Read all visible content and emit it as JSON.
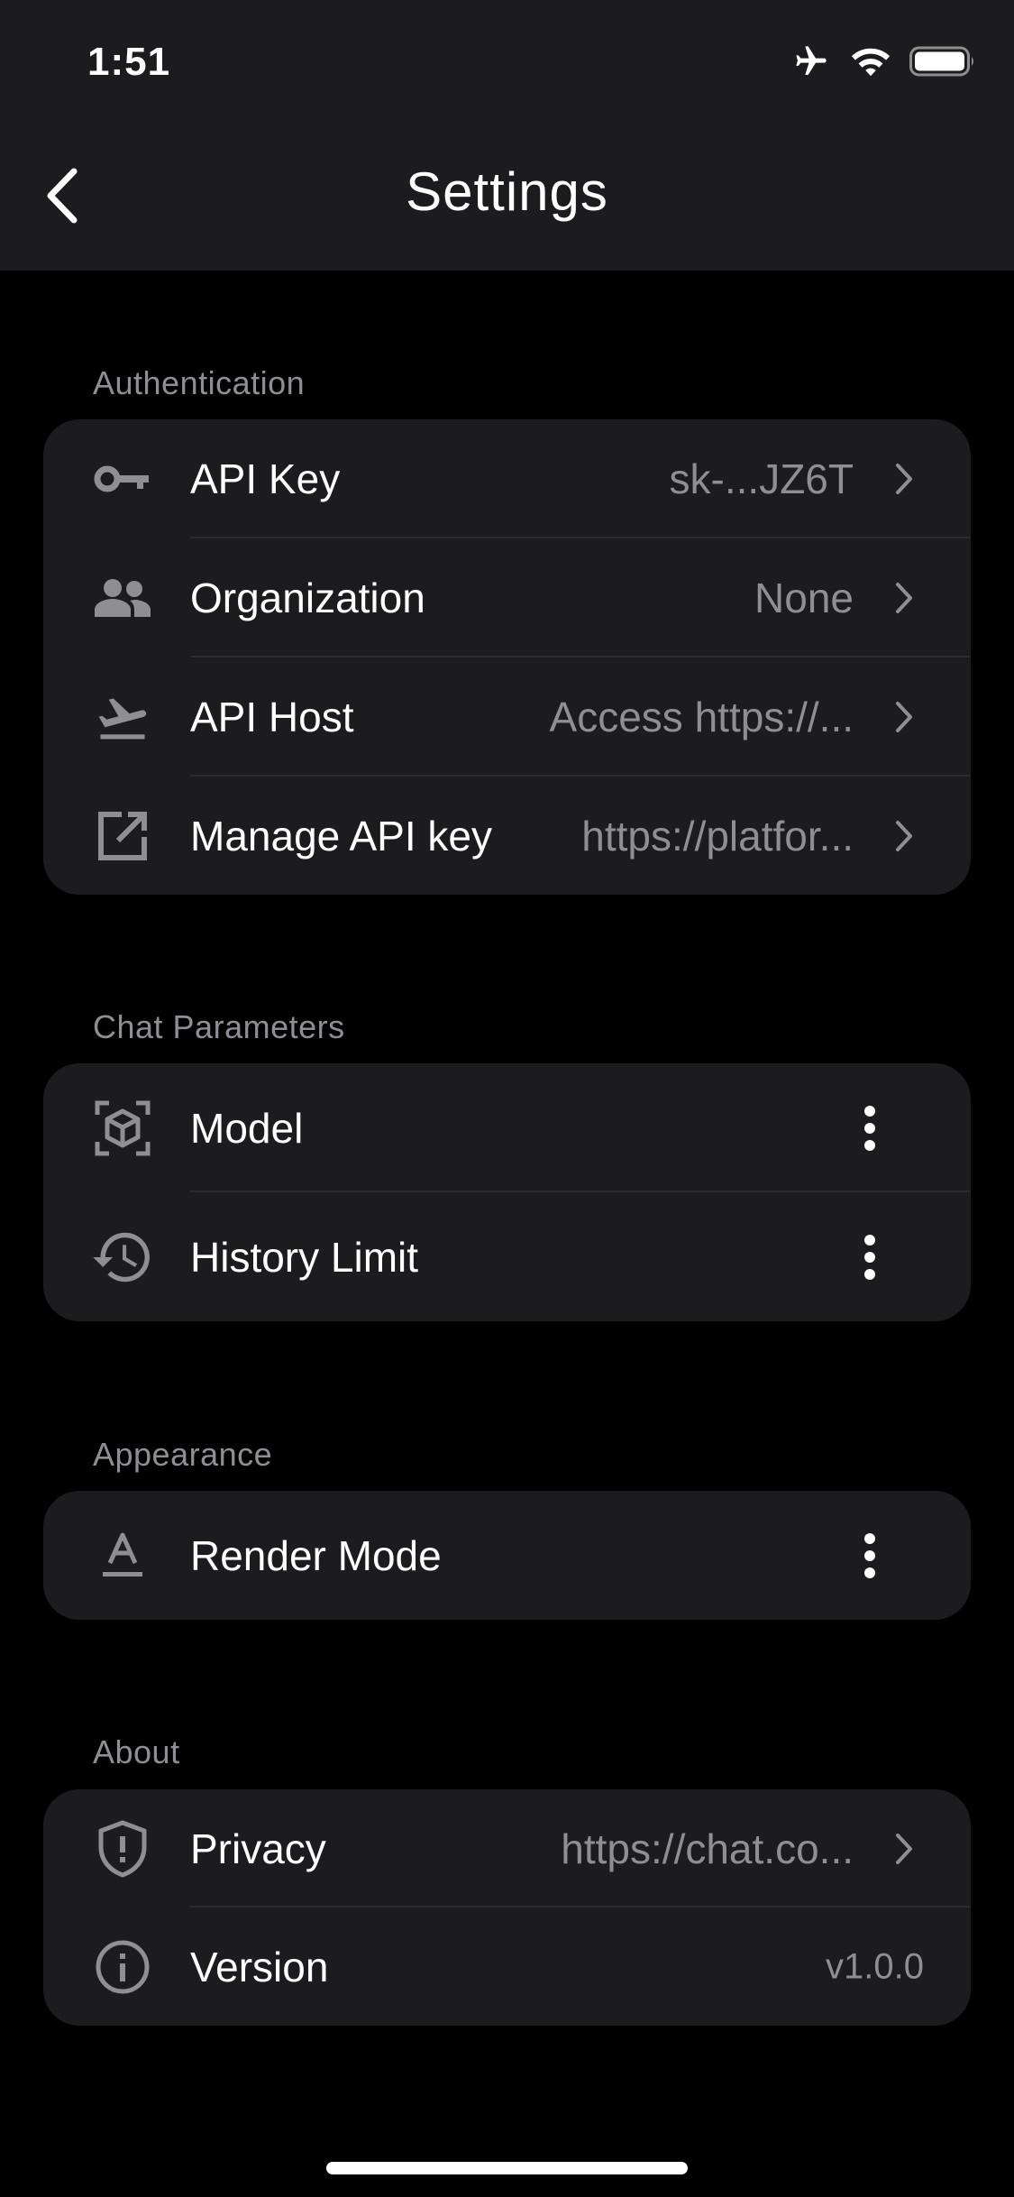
{
  "status_bar": {
    "time": "1:51"
  },
  "nav": {
    "title": "Settings"
  },
  "sections": {
    "authentication": {
      "header": "Authentication",
      "api_key": {
        "label": "API Key",
        "value": "sk-...JZ6T"
      },
      "organization": {
        "label": "Organization",
        "value": "None"
      },
      "api_host": {
        "label": "API Host",
        "value": "Access https://..."
      },
      "manage_api_key": {
        "label": "Manage API key",
        "value": "https://platfor..."
      }
    },
    "chat_parameters": {
      "header": "Chat Parameters",
      "model": {
        "label": "Model"
      },
      "history_limit": {
        "label": "History Limit"
      }
    },
    "appearance": {
      "header": "Appearance",
      "render_mode": {
        "label": "Render Mode"
      }
    },
    "about": {
      "header": "About",
      "privacy": {
        "label": "Privacy",
        "value": "https://chat.co..."
      },
      "version": {
        "label": "Version",
        "value": "v1.0.0"
      }
    }
  },
  "colors": {
    "background": "#000000",
    "card": "#1c1c1e",
    "secondary_text": "#8e8e93",
    "divider": "#2c2c2e"
  },
  "icons": {
    "status": [
      "airplane-icon",
      "wifi-icon",
      "battery-icon"
    ],
    "rows": [
      "key-icon",
      "group-icon",
      "flight-takeoff-icon",
      "open-external-icon",
      "model-box-icon",
      "history-icon",
      "text-format-icon",
      "shield-icon",
      "info-icon"
    ]
  }
}
